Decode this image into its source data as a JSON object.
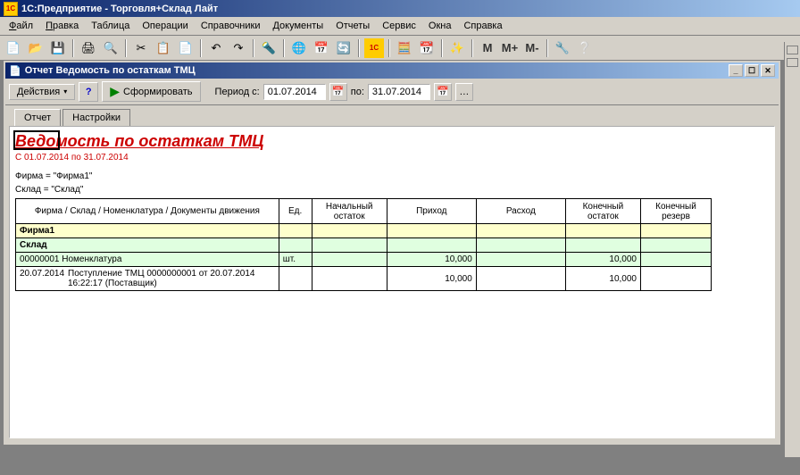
{
  "app": {
    "title": "1С:Предприятие - Торговля+Склад Лайт"
  },
  "menu": {
    "file": "Файл",
    "edit": "Правка",
    "table": "Таблица",
    "operations": "Операции",
    "refs": "Справочники",
    "docs": "Документы",
    "reports": "Отчеты",
    "service": "Сервис",
    "windows": "Окна",
    "help": "Справка"
  },
  "child": {
    "title": "Отчет  Ведомость по остаткам ТМЦ",
    "actions": "Действия",
    "form": "Сформировать",
    "period_from_label": "Период с:",
    "period_from": "01.07.2014",
    "period_to_label": "по:",
    "period_to": "31.07.2014",
    "tab_report": "Отчет",
    "tab_settings": "Настройки"
  },
  "report": {
    "title": "Ведомость по остаткам ТМЦ",
    "period_text": "С 01.07.2014 по 31.07.2014",
    "filter_firma": "Фирма = \"Фирма1\"",
    "filter_sklad": "Склад = \"Склад\"",
    "headers": {
      "col1": "Фирма / Склад / Номенклатура / Документы движения",
      "col2": "Ед.",
      "col3": "Начальный остаток",
      "col4": "Приход",
      "col5": "Расход",
      "col6": "Конечный остаток",
      "col7": "Конечный резерв"
    },
    "rows": {
      "firma": "Фирма1",
      "sklad": "Склад",
      "nomen_code": "00000001 Номенклатура",
      "nomen_unit": "шт.",
      "nomen_prihod": "10,000",
      "nomen_kon": "10,000",
      "doc_date": "20.07.2014",
      "doc_text": "Поступление ТМЦ 0000000001 от 20.07.2014 16:22:17 (Поставщик)",
      "doc_prihod": "10,000",
      "doc_kon": "10,000"
    }
  },
  "toolbar_labels": {
    "m": "M",
    "mplus": "M+",
    "mminus": "M-"
  }
}
